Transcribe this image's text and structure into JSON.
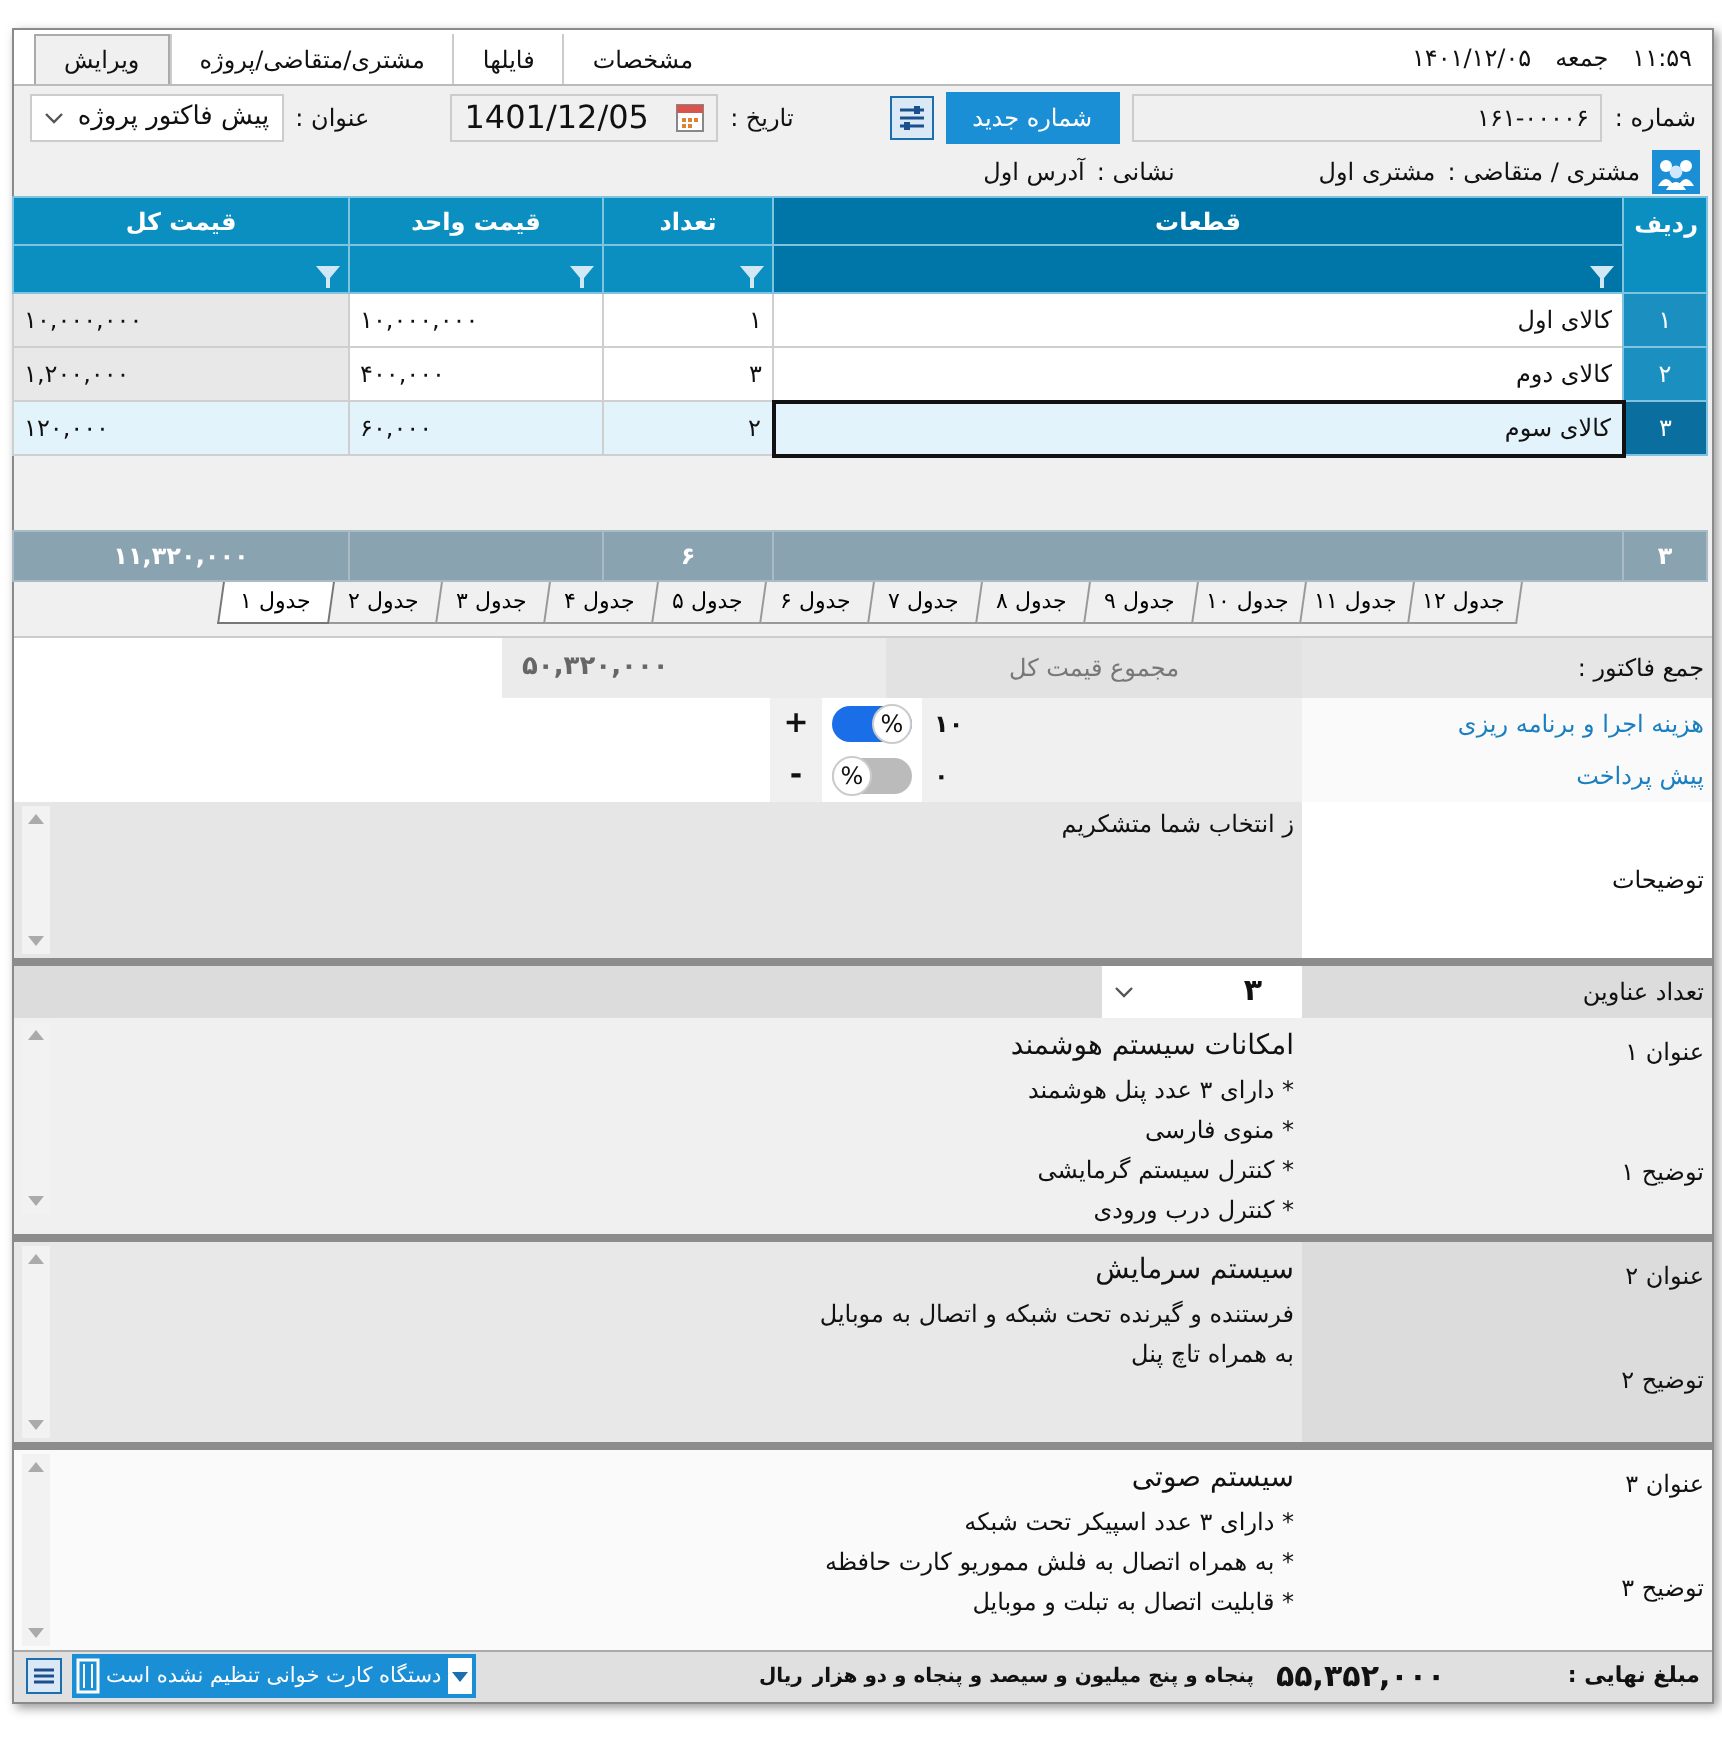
{
  "clock": {
    "time": "۱۱:۵۹",
    "weekday": "جمعه",
    "date": "۱۴۰۱/۱۲/۰۵"
  },
  "tabs": [
    {
      "label": "مشخصات",
      "selected": false
    },
    {
      "label": "فایلها",
      "selected": false
    },
    {
      "label": "مشتری/متقاضی/پروژه",
      "selected": false
    },
    {
      "label": "ویرایش",
      "selected": true
    }
  ],
  "form": {
    "number_label": "شماره :",
    "number": "۱۶۱-۰۰۰۰۶",
    "new_number_button": "شماره جدید",
    "date_label": "تاریخ :",
    "date": "1401/12/05",
    "title_label": "عنوان :",
    "title": "پیش فاکتور پروژه",
    "customer_label": "مشتری / متقاضی :",
    "customer": "مشتری اول",
    "address_label": "نشانی :",
    "address": "آدرس اول"
  },
  "grid": {
    "columns": [
      "ردیف",
      "قطعات",
      "تعداد",
      "قیمت واحد",
      "قیمت کل"
    ],
    "rows": [
      {
        "index": "۱",
        "item": "کالای اول",
        "qty": "۱",
        "unit_price": "۱۰,۰۰۰,۰۰۰",
        "total": "۱۰,۰۰۰,۰۰۰",
        "selected": false
      },
      {
        "index": "۲",
        "item": "کالای دوم",
        "qty": "۳",
        "unit_price": "۴۰۰,۰۰۰",
        "total": "۱,۲۰۰,۰۰۰",
        "selected": false
      },
      {
        "index": "۳",
        "item": "کالای سوم",
        "qty": "۲",
        "unit_price": "۶۰,۰۰۰",
        "total": "۱۲۰,۰۰۰",
        "selected": true
      }
    ],
    "footer": {
      "index": "۳",
      "qty": "۶",
      "total": "۱۱,۳۲۰,۰۰۰"
    }
  },
  "sheets": [
    {
      "label": "جدول ۱۲",
      "selected": false
    },
    {
      "label": "جدول ۱۱",
      "selected": false
    },
    {
      "label": "جدول ۱۰",
      "selected": false
    },
    {
      "label": "جدول ۹",
      "selected": false
    },
    {
      "label": "جدول ۸",
      "selected": false
    },
    {
      "label": "جدول ۷",
      "selected": false
    },
    {
      "label": "جدول ۶",
      "selected": false
    },
    {
      "label": "جدول ۵",
      "selected": false
    },
    {
      "label": "جدول ۴",
      "selected": false
    },
    {
      "label": "جدول ۳",
      "selected": false
    },
    {
      "label": "جدول ۲",
      "selected": false
    },
    {
      "label": "جدول ۱",
      "selected": true
    }
  ],
  "summary": {
    "label": "جمع فاکتور :",
    "caption": "مجموع قیمت کل",
    "total": "۵۰,۳۲۰,۰۰۰"
  },
  "adjustments": [
    {
      "label": "هزینه اجرا و برنامه ریزی",
      "value": "۱۰",
      "toggle_label": "%",
      "on": true,
      "sign": "+"
    },
    {
      "label": "پیش پرداخت",
      "value": "۰",
      "toggle_label": "%",
      "on": false,
      "sign": "-"
    }
  ],
  "notes": {
    "label": "توضیحات",
    "text": "ز انتخاب شما متشکریم"
  },
  "title_count": {
    "label": "تعداد عناوین",
    "value": "۳"
  },
  "sections": [
    {
      "title_label": "عنوان ۱",
      "desc_label": "توضیح ۱",
      "title": "امکانات سیستم هوشمند",
      "lines": [
        "* دارای ۳ عدد پنل هوشمند",
        "* منوی فارسی",
        "* کنترل سیستم گرمایشی",
        "* کنترل درب ورودی"
      ],
      "selected": false
    },
    {
      "title_label": "عنوان ۲",
      "desc_label": "توضیح ۲",
      "title": "سیستم سرمایش",
      "lines": [
        "فرستنده و گیرنده تحت شبکه و اتصال به موبایل",
        "به همراه تاچ پنل"
      ],
      "selected": true
    },
    {
      "title_label": "عنوان ۳",
      "desc_label": "توضیح ۳",
      "title": "سیستم صوتی",
      "lines": [
        "* دارای ۳ عدد اسپیکر تحت شبکه",
        "* به همراه اتصال به فلش مموریو کارت حافظه",
        "* قابلیت اتصال به تبلت و موبایل"
      ],
      "selected": false
    }
  ],
  "footer": {
    "label": "مبلغ نهایی :",
    "amount": "۵۵,۳۵۲,۰۰۰",
    "amount_words": "پنجاه و پنج میلیون و سیصد و پنجاه و دو هزار",
    "currency": "ریال",
    "card_reader": "دستگاه کارت خوانی تنظیم نشده است"
  }
}
